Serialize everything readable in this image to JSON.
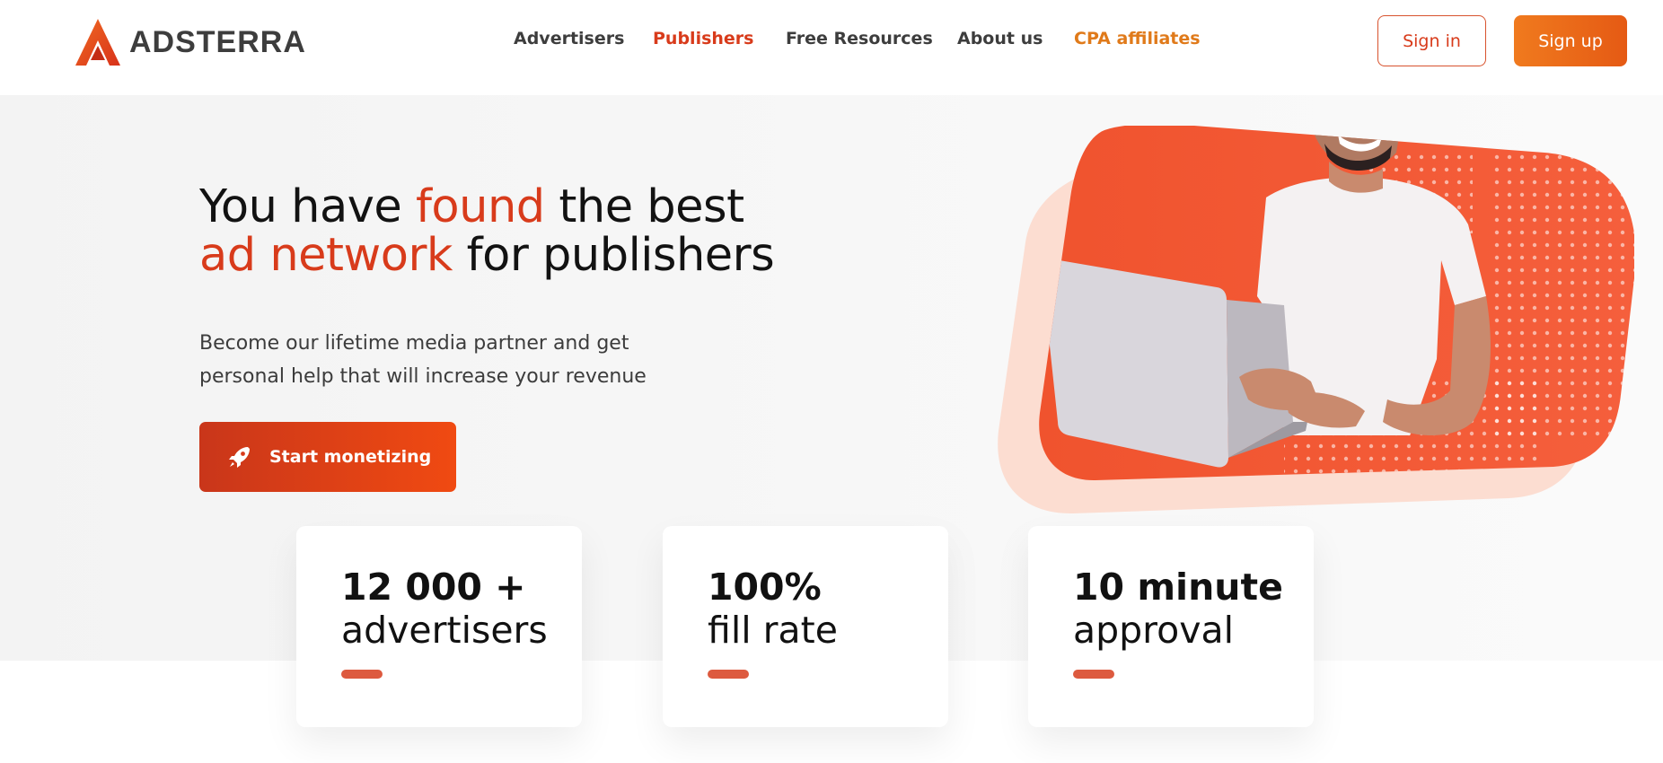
{
  "brand": {
    "name": "ADSTERRA",
    "accent": "#d83b1b"
  },
  "nav": {
    "items": [
      {
        "label": "Advertisers"
      },
      {
        "label": "Publishers"
      },
      {
        "label": "Free Resources"
      },
      {
        "label": "About us"
      },
      {
        "label": "CPA affiliates"
      }
    ]
  },
  "auth": {
    "signin_label": "Sign in",
    "signup_label": "Sign up"
  },
  "hero": {
    "headline": {
      "part1": "You have ",
      "part2": "found",
      "part3": " the best",
      "part4": "ad network",
      "part5": " for publishers"
    },
    "subtext_line1": "Become our lifetime media partner and get",
    "subtext_line2": "personal help that will increase your revenue",
    "cta_label": "Start monetizing",
    "cta_icon": "rocket-icon",
    "illustration": "man-with-laptop"
  },
  "stats": [
    {
      "value": "12 000 +",
      "label": "advertisers"
    },
    {
      "value": "100%",
      "label": "fill rate"
    },
    {
      "value": "10 minute",
      "label": "approval"
    }
  ]
}
